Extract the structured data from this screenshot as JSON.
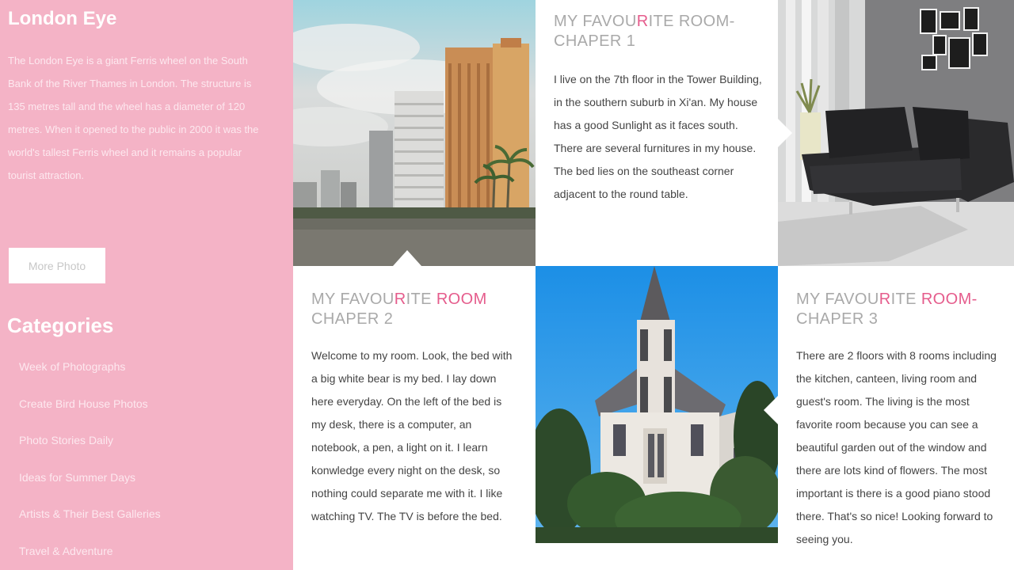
{
  "sidebar": {
    "title": "London Eye",
    "description": "The London Eye is a giant Ferris wheel on the South Bank of the River Thames in London. The structure is 135 metres tall and the wheel has a diameter of 120 metres. When it opened to the public in 2000 it was the world's tallest Ferris wheel and it remains a popular tourist attraction.",
    "button_label": "More Photo",
    "categories_title": "Categories",
    "categories": [
      "Week of Photographs",
      "Create Bird House Photos",
      "Photo Stories Daily",
      "Ideas for Summer Days",
      "Artists & Their Best Galleries",
      "Travel & Adventure"
    ]
  },
  "tiles": {
    "chapter1": {
      "heading_pre": "MY FAVOU",
      "heading_hl": "R",
      "heading_post": "ITE ROOM-",
      "heading_line2": "CHAPER 1",
      "body": "I live on the 7th floor in the Tower Building, in the southern suburb in Xi'an. My house has a good Sunlight as it faces south. There are several furnitures in my house. The bed lies on the southeast corner adjacent to the round table."
    },
    "chapter2": {
      "heading_pre": "MY FAVOU",
      "heading_hl": "R",
      "heading_mid": "ITE ",
      "heading_hl2": "ROOM",
      "heading_post": "",
      "heading_line2": "CHAPER 2",
      "body": "Welcome to my room. Look, the bed with a big white bear is my bed. I lay down here everyday. On the left of the bed is my desk, there is a computer, an notebook, a pen, a light on it. I learn konwledge every night on the desk, so nothing could separate me with it. I like watching TV. The TV is before the bed."
    },
    "chapter3": {
      "heading_pre": "MY FAVOU",
      "heading_hl": "R",
      "heading_mid": "ITE ",
      "heading_hl2": "ROOM-",
      "heading_post": "",
      "heading_line2": "CHAPER 3",
      "body": "There are 2 floors with 8 rooms including the kitchen, canteen, living room and guest's room. The living is the most favorite room because you can see a beautiful garden out of the window and there are lots kind of flowers. The most important is there is a good piano stood there. That's so nice! Looking forward to seeing you."
    }
  },
  "colors": {
    "sidebar_bg": "#f4b3c6",
    "accent": "#e55c8c",
    "heading_gray": "#a9a9a9",
    "body_text": "#444444"
  }
}
